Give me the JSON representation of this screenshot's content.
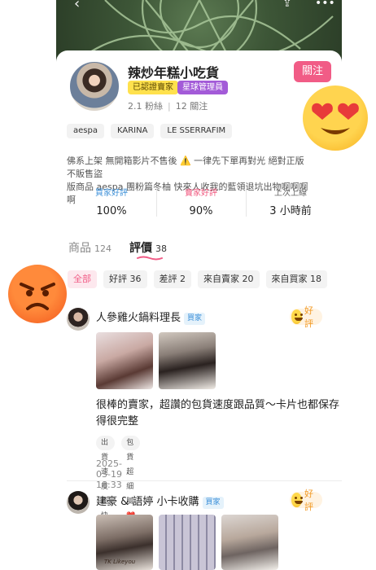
{
  "seller": {
    "name": "辣炒年糕小吃貨",
    "badge_verified": "已認證賣家",
    "badge_admin": "星球管理員",
    "followers": "2.1 粉絲",
    "following": "12 關注",
    "follow_label": "關注",
    "tags": [
      "aespa",
      "KARINA",
      "LE SSERRAFIM"
    ],
    "bio_line1": "佛系上架 無開箱影片不售後 ⚠️ 一律先下單再對光 絕對正版 不販售盜",
    "bio_line2": "版商品 aespa 團粉篇冬柚 快來人收我的藍領退坑出物啊啊啊啊",
    "metrics": [
      {
        "label": "買家好評",
        "value": "100%"
      },
      {
        "label": "賣家好評",
        "value": "90%"
      },
      {
        "label": "上次上線",
        "value": "3 小時前"
      }
    ]
  },
  "tabs": [
    {
      "label": "商品",
      "count": "124"
    },
    {
      "label": "評價",
      "count": "38"
    }
  ],
  "filters": [
    "全部",
    "好評 36",
    "差評 2",
    "來自賣家 20",
    "來自買家 18"
  ],
  "reviews": [
    {
      "name": "人參雞火鍋料理長",
      "buyer_tag": "買家",
      "rating": "好評",
      "text_line1": "很棒的賣家，超讚的包貨速度跟品質～卡片也都保存",
      "text_line2": "得很完整",
      "tags": [
        "出貨速度超快 🚀",
        "包貨超細膩 ❤️"
      ],
      "date": "2025-03-19 18:33"
    },
    {
      "name": "建豪 & 語婷 小卡收購",
      "buyer_tag": "買家",
      "rating": "好評",
      "photo_caption": "TK Likeyou"
    }
  ],
  "colors": {
    "accent": "#f15c86",
    "verified": "#ffe14d",
    "admin": "#a35bd8",
    "blue": "#3b8fd8"
  },
  "icons": [
    "back-icon",
    "share-icon",
    "more-icon",
    "love-eyes-emoji",
    "angry-emoji",
    "smile-emoji"
  ]
}
